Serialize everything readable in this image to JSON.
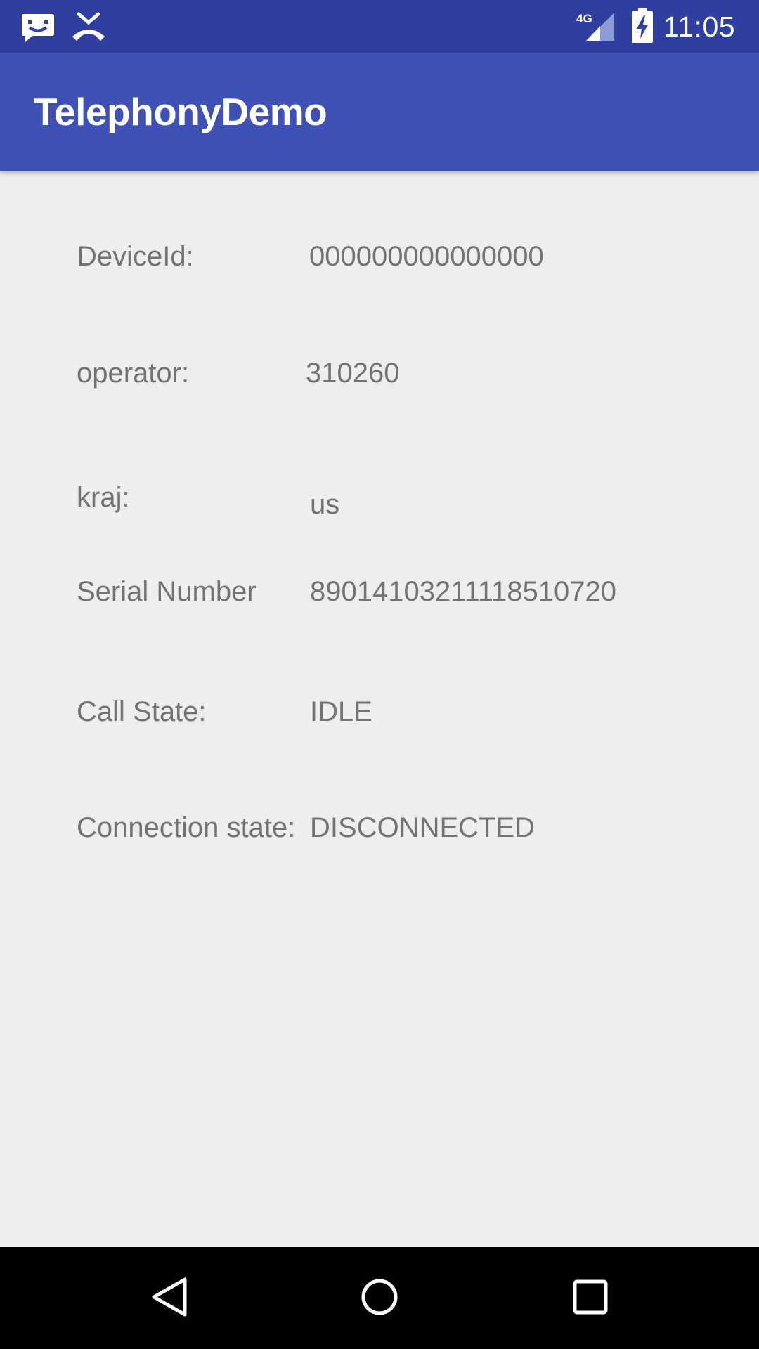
{
  "status_bar": {
    "time": "11:05",
    "network_label": "4G",
    "icons": [
      "messaging-notification-icon",
      "missed-call-icon",
      "signal-4g-icon",
      "battery-charging-icon"
    ]
  },
  "app_bar": {
    "title": "TelephonyDemo"
  },
  "info_rows": [
    {
      "label": "DeviceId:",
      "value": "000000000000000"
    },
    {
      "label": "operator:",
      "value": "310260"
    },
    {
      "label": "kraj:",
      "value": "us"
    },
    {
      "label": "Serial Number",
      "value": "89014103211118510720"
    },
    {
      "label": "Call State:",
      "value": "IDLE"
    },
    {
      "label": "Connection state:",
      "value": "DISCONNECTED"
    }
  ],
  "nav_bar": {
    "buttons": [
      "back-icon",
      "home-icon",
      "recents-icon"
    ]
  },
  "colors": {
    "status_bar": "#303F9F",
    "app_bar": "#3F51B5",
    "background": "#EEEEEE",
    "text": "#737373",
    "nav_bar": "#000000"
  }
}
